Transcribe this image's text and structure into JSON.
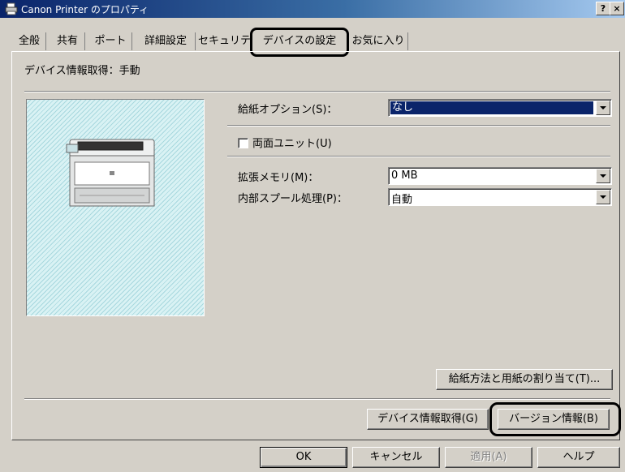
{
  "window": {
    "title": "Canon Printer のプロパティ",
    "help_button": "?",
    "close_button": "×"
  },
  "tabs": [
    {
      "label": "全般"
    },
    {
      "label": "共有"
    },
    {
      "label": "ポート"
    },
    {
      "label": "詳細設定"
    },
    {
      "label": "セキュリテ"
    },
    {
      "label": "デバイスの設定",
      "active": true
    },
    {
      "label": "お気に入り"
    }
  ],
  "device": {
    "info_status": "デバイス情報取得：手動",
    "paper_option_label": "給紙オプション(S)：",
    "paper_option_value": "なし",
    "duplex_label": "両面ユニット(U)",
    "duplex_checked": false,
    "memory_label": "拡張メモリ(M)：",
    "memory_value": "0 MB",
    "spool_label": "内部スプール処理(P)：",
    "spool_value": "自動",
    "assign_paper_button": "給紙方法と用紙の割り当て(T)...",
    "get_info_button": "デバイス情報取得(G)",
    "version_button": "バージョン情報(B)"
  },
  "footer": {
    "ok": "OK",
    "cancel": "キャンセル",
    "apply": "適用(A)",
    "help": "ヘルプ"
  },
  "icons": {
    "app": "printer-icon",
    "preview": "printer-image"
  }
}
